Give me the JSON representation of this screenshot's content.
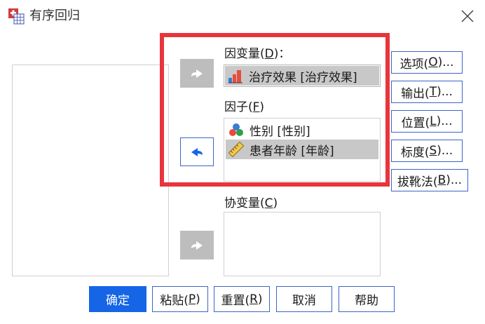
{
  "window": {
    "title": "有序回归",
    "close_symbol": "╳"
  },
  "dependent": {
    "label": "因变量",
    "mnemonic": "D",
    "suffix": "：",
    "item": {
      "name": "治疗效果",
      "tag": "[治疗效果]",
      "icon": "ordinal-bar-icon"
    }
  },
  "factors": {
    "label": "因子",
    "mnemonic": "F",
    "items": [
      {
        "name": "性别",
        "tag": "[性别]",
        "icon": "nominal-balls-icon",
        "selected": false
      },
      {
        "name": "患者年龄",
        "tag": "[年龄]",
        "icon": "scale-ruler-icon",
        "selected": true
      }
    ]
  },
  "covariates": {
    "label": "协变量",
    "mnemonic": "C"
  },
  "side_buttons": {
    "options": {
      "text": "选项(",
      "key": "O",
      "end": ")..."
    },
    "output": {
      "text": "输出(",
      "key": "T",
      "end": ")..."
    },
    "location": {
      "text": "位置(",
      "key": "L",
      "end": ")..."
    },
    "scale": {
      "text": "标度(",
      "key": "S",
      "end": ")..."
    },
    "bootstrap": {
      "text": "拔靴法(",
      "key": "B",
      "end": ")..."
    }
  },
  "bottom_buttons": {
    "ok": {
      "text": "确定"
    },
    "paste": {
      "text": "粘贴(",
      "key": "P",
      "end": ")"
    },
    "reset": {
      "text": "重置(",
      "key": "R",
      "end": ")"
    },
    "cancel": {
      "text": "取消"
    },
    "help": {
      "text": "帮助"
    }
  },
  "colors": {
    "highlight": "#e8353b",
    "primary": "#1565e6",
    "button_border": "#3d63c9",
    "arrow_gray": "#bdbdbd",
    "selection": "#c8c8c8"
  }
}
